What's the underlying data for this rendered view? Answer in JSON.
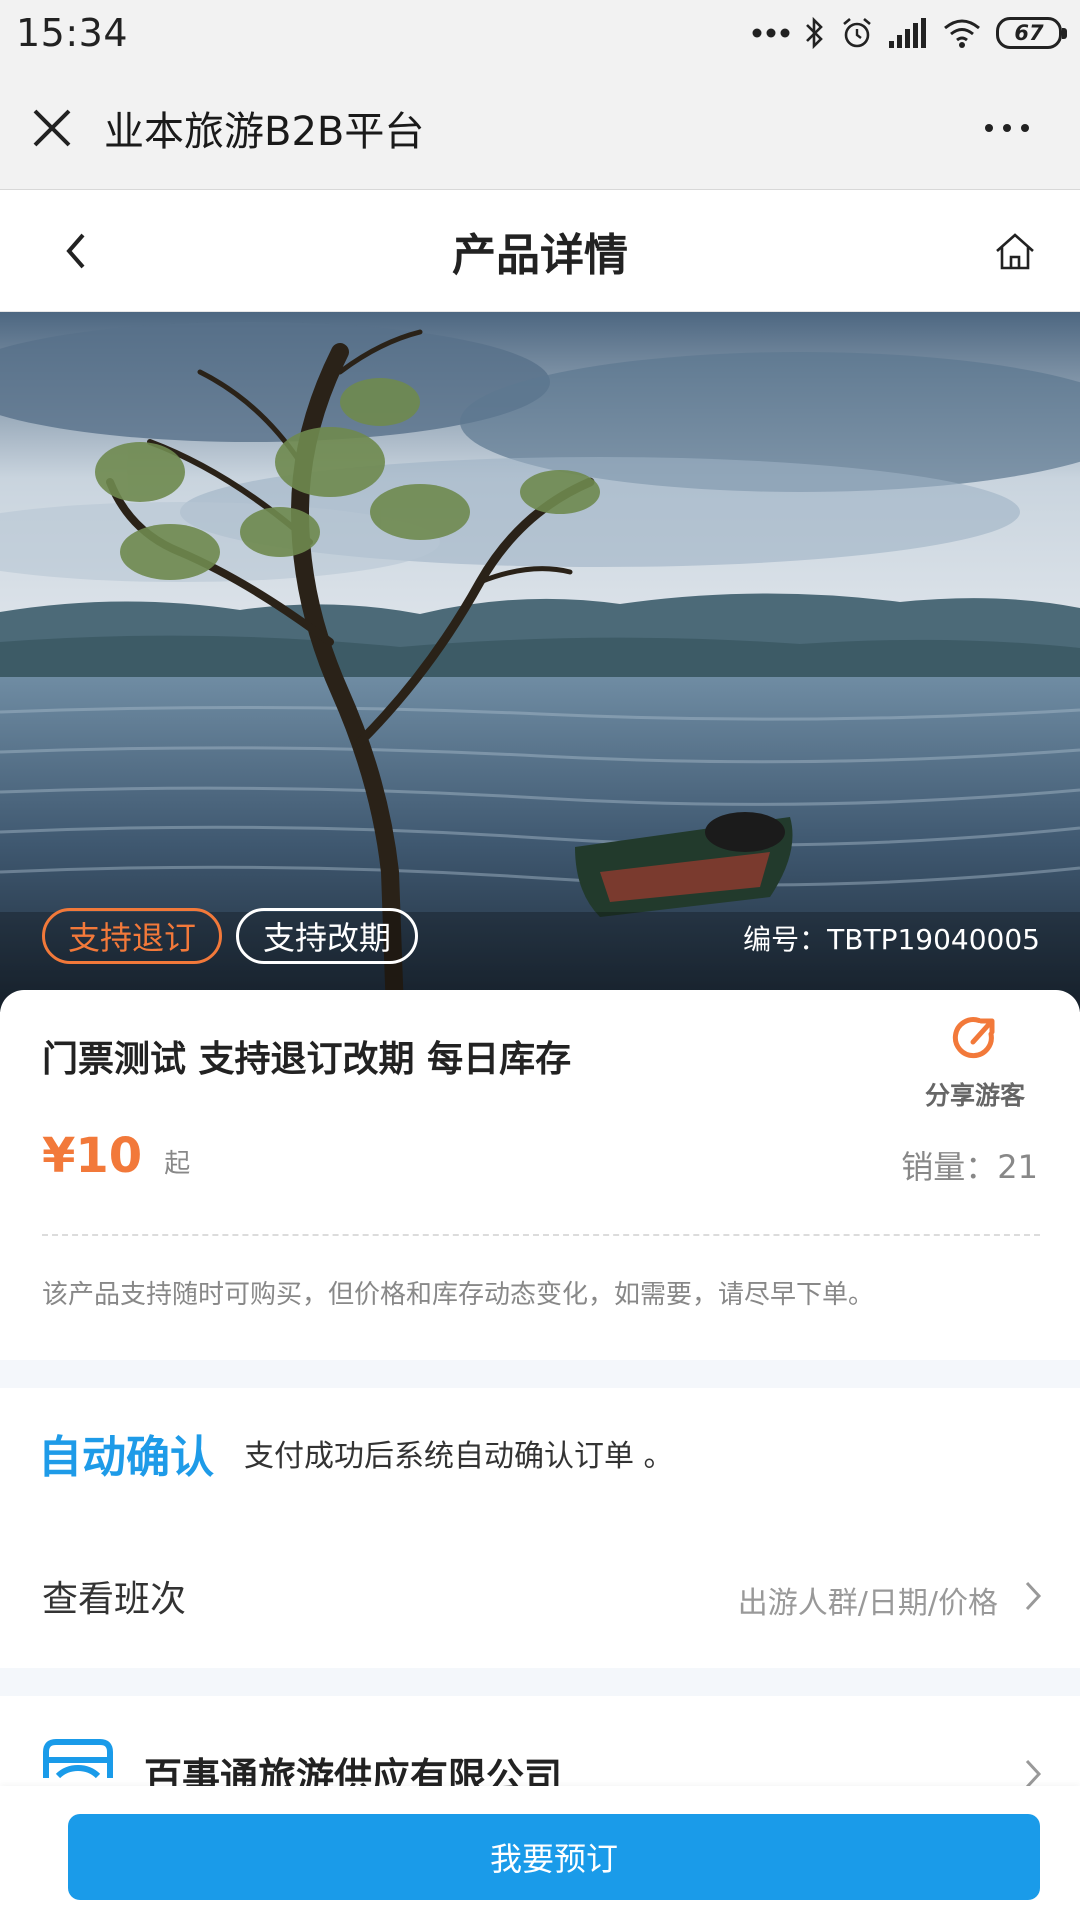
{
  "status_bar": {
    "time": "15:34",
    "battery": "67"
  },
  "wechat_bar": {
    "title": "业本旅游B2B平台"
  },
  "header": {
    "title": "产品详情"
  },
  "hero": {
    "tags": [
      "支持退订",
      "支持改期"
    ],
    "product_code": "编号：TBTP19040005"
  },
  "product": {
    "name": "门票测试 支持退订改期 每日库存",
    "share_label": "分享游客",
    "price": "¥10",
    "price_suffix": "起",
    "sales": "销量：21",
    "notice": "该产品支持随时可购买，但价格和库存动态变化，如需要，请尽早下单。"
  },
  "confirm": {
    "badge": "自动确认",
    "text": "支付成功后系统自动确认订单 。"
  },
  "schedule": {
    "label": "查看班次",
    "hint": "出游人群/日期/价格"
  },
  "supplier": {
    "name": "百事通旅游供应有限公司"
  },
  "footer": {
    "book_label": "我要预订"
  },
  "colors": {
    "accent_orange": "#f2793a",
    "primary_blue": "#1a9be9"
  },
  "icons": [
    "close-icon",
    "more-icon",
    "back-icon",
    "home-icon",
    "share-icon",
    "chevron-right-icon",
    "supplier-icon"
  ]
}
